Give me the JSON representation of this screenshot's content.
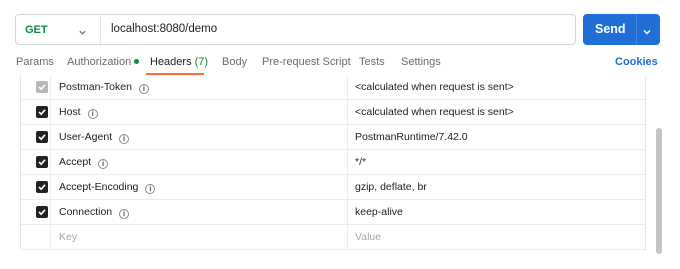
{
  "request": {
    "method": "GET",
    "url": "localhost:8080/demo",
    "send_label": "Send"
  },
  "tabs": [
    {
      "label": "Params"
    },
    {
      "label": "Authorization"
    },
    {
      "label": "Headers",
      "count": "(7)"
    },
    {
      "label": "Body"
    },
    {
      "label": "Pre-request Script"
    },
    {
      "label": "Tests"
    },
    {
      "label": "Settings"
    }
  ],
  "active_tab": "Headers",
  "cookies_label": "Cookies",
  "headers": [
    {
      "key": "Postman-Token",
      "value": "<calculated when request is sent>",
      "checked": true,
      "disabled": true
    },
    {
      "key": "Host",
      "value": "<calculated when request is sent>",
      "checked": true,
      "disabled": false
    },
    {
      "key": "User-Agent",
      "value": "PostmanRuntime/7.42.0",
      "checked": true,
      "disabled": false
    },
    {
      "key": "Accept",
      "value": "*/*",
      "checked": true,
      "disabled": false
    },
    {
      "key": "Accept-Encoding",
      "value": "gzip, deflate, br",
      "checked": true,
      "disabled": false
    },
    {
      "key": "Connection",
      "value": "keep-alive",
      "checked": true,
      "disabled": false
    }
  ],
  "new_row": {
    "key_placeholder": "Key",
    "value_placeholder": "Value"
  },
  "colors": {
    "send": "#1f6fd6",
    "method": "#0b8a3d",
    "active_underline": "#ff6c37",
    "auth_dot": "#0b8a3d"
  },
  "icons": {
    "info": "info-circle-icon",
    "check": "check-icon",
    "chevron": "chevron-down-icon"
  }
}
